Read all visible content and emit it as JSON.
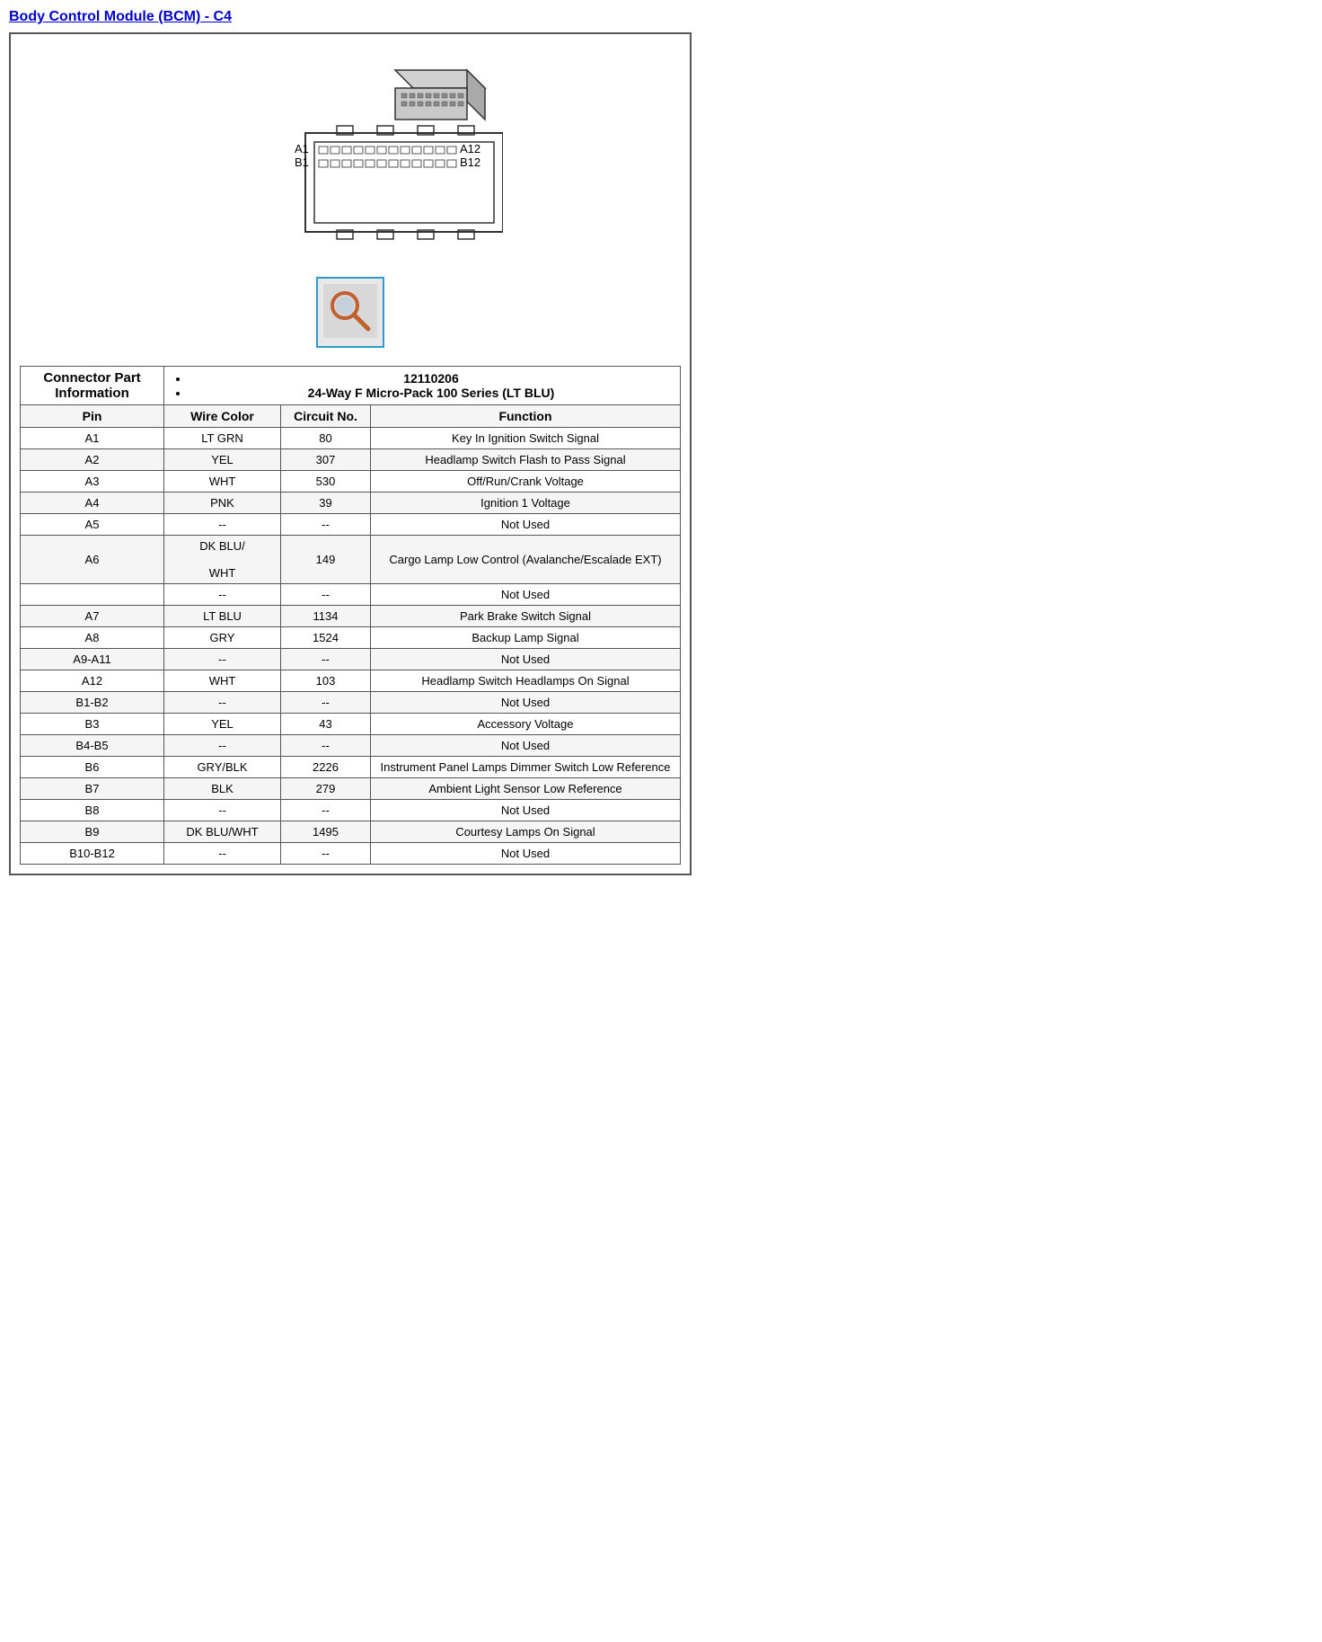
{
  "title": "Body Control Module (BCM) - C4",
  "connector_info": {
    "label": "Connector Part Information",
    "items": [
      "12110206",
      "24-Way F Micro-Pack 100 Series (LT BLU)"
    ]
  },
  "table_headers": {
    "pin": "Pin",
    "wire_color": "Wire Color",
    "circuit_no": "Circuit No.",
    "function": "Function"
  },
  "rows": [
    {
      "pin": "A1",
      "wire_color": "LT GRN",
      "circuit_no": "80",
      "function": "Key In Ignition Switch Signal"
    },
    {
      "pin": "A2",
      "wire_color": "YEL",
      "circuit_no": "307",
      "function": "Headlamp Switch Flash to Pass Signal"
    },
    {
      "pin": "A3",
      "wire_color": "WHT",
      "circuit_no": "530",
      "function": "Off/Run/Crank Voltage"
    },
    {
      "pin": "A4",
      "wire_color": "PNK",
      "circuit_no": "39",
      "function": "Ignition 1 Voltage"
    },
    {
      "pin": "A5",
      "wire_color": "--",
      "circuit_no": "--",
      "function": "Not Used"
    },
    {
      "pin": "A6",
      "wire_color": "DK BLU/\n\nWHT",
      "circuit_no": "149",
      "function": "Cargo Lamp Low Control (Avalanche/Escalade EXT)"
    },
    {
      "pin": "",
      "wire_color": "--",
      "circuit_no": "--",
      "function": "Not Used"
    },
    {
      "pin": "A7",
      "wire_color": "LT BLU",
      "circuit_no": "1134",
      "function": "Park Brake Switch Signal"
    },
    {
      "pin": "A8",
      "wire_color": "GRY",
      "circuit_no": "1524",
      "function": "Backup Lamp Signal"
    },
    {
      "pin": "A9-A11",
      "wire_color": "--",
      "circuit_no": "--",
      "function": "Not Used"
    },
    {
      "pin": "A12",
      "wire_color": "WHT",
      "circuit_no": "103",
      "function": "Headlamp Switch Headlamps On Signal"
    },
    {
      "pin": "B1-B2",
      "wire_color": "--",
      "circuit_no": "--",
      "function": "Not Used"
    },
    {
      "pin": "B3",
      "wire_color": "YEL",
      "circuit_no": "43",
      "function": "Accessory Voltage"
    },
    {
      "pin": "B4-B5",
      "wire_color": "--",
      "circuit_no": "--",
      "function": "Not Used"
    },
    {
      "pin": "B6",
      "wire_color": "GRY/BLK",
      "circuit_no": "2226",
      "function": "Instrument Panel Lamps Dimmer Switch Low Reference"
    },
    {
      "pin": "B7",
      "wire_color": "BLK",
      "circuit_no": "279",
      "function": "Ambient Light Sensor Low Reference"
    },
    {
      "pin": "B8",
      "wire_color": "--",
      "circuit_no": "--",
      "function": "Not Used"
    },
    {
      "pin": "B9",
      "wire_color": "DK BLU/WHT",
      "circuit_no": "1495",
      "function": "Courtesy Lamps On Signal"
    },
    {
      "pin": "B10-B12",
      "wire_color": "--",
      "circuit_no": "--",
      "function": "Not Used"
    }
  ]
}
